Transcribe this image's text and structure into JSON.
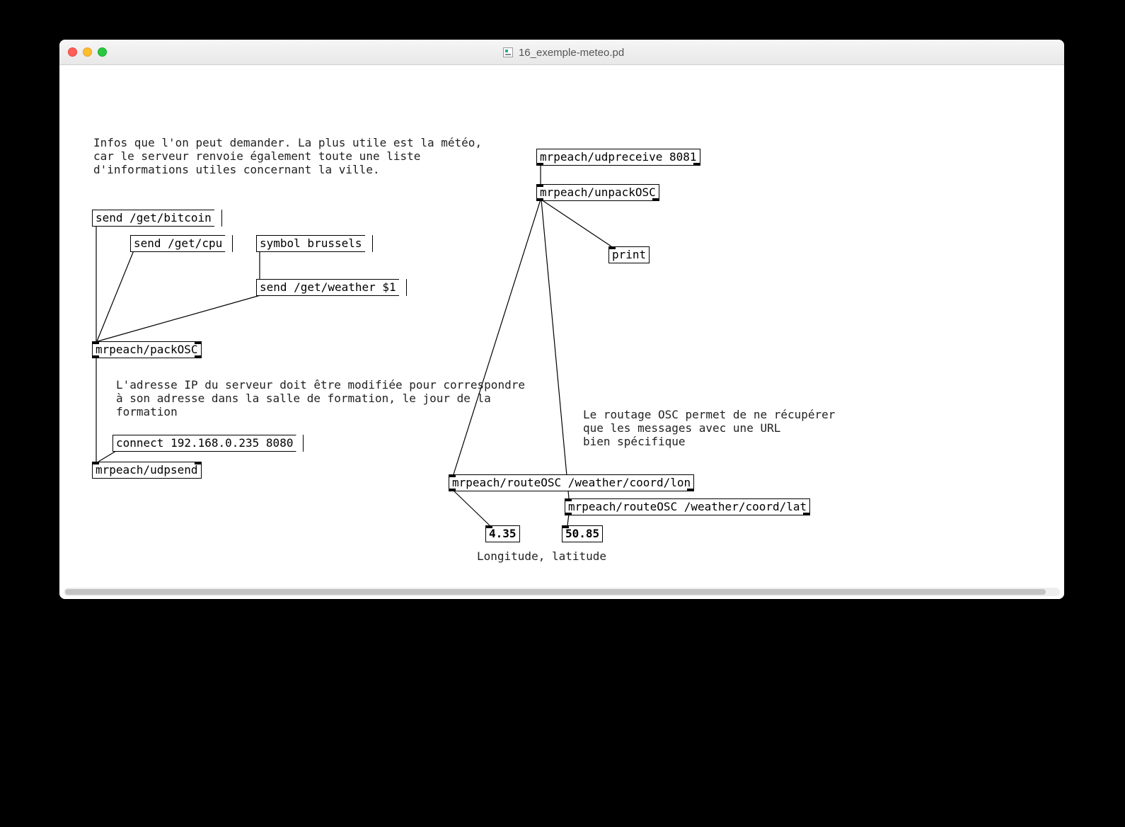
{
  "window": {
    "title": "16_exemple-meteo.pd"
  },
  "comments": {
    "top": "Infos que l'on peut demander. La plus utile est la météo,\ncar le serveur renvoie également toute une liste\nd'informations utiles concernant la ville.",
    "ip": "L'adresse IP du serveur doit être modifiée pour correspondre\nà son adresse dans la salle de formation, le jour de la\nformation",
    "routing": "Le routage OSC permet de ne récupérer\nque les messages avec une URL\nbien spécifique",
    "lonlat": "Longitude, latitude"
  },
  "msgs": {
    "bitcoin": "send /get/bitcoin",
    "cpu": "send /get/cpu",
    "symbol": "symbol brussels",
    "weather": "send /get/weather $1",
    "connect": "connect 192.168.0.235 8080"
  },
  "objs": {
    "packosc": "mrpeach/packOSC",
    "udpsend": "mrpeach/udpsend",
    "udpreceive": "mrpeach/udpreceive 8081",
    "unpackosc": "mrpeach/unpackOSC",
    "print": "print",
    "route_lon": "mrpeach/routeOSC /weather/coord/lon",
    "route_lat": "mrpeach/routeOSC /weather/coord/lat"
  },
  "numbers": {
    "lon": "4.35",
    "lat": "50.85"
  }
}
